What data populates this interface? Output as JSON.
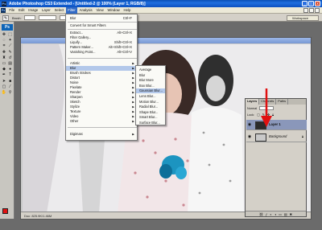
{
  "window": {
    "title": "Adobe Photoshop CS3 Extended - [Untitled-2 @ 100% (Layer 1, RGB/8)]",
    "app_icon": "Ps",
    "buttons": [
      "_",
      "□",
      "x"
    ]
  },
  "menubar": {
    "logo": "Ps",
    "items": [
      "File",
      "Edit",
      "Image",
      "Layer",
      "Select",
      "Filter",
      "Analysis",
      "View",
      "Window",
      "Help"
    ],
    "active": "Filter"
  },
  "options": {
    "brush_label": "Brush:",
    "workspace": "Workspace"
  },
  "filter_menu": {
    "top": [
      {
        "label": "Blur",
        "shortcut": "Ctrl+F"
      }
    ],
    "group1": [
      {
        "label": "Convert for Smart Filters"
      }
    ],
    "group2": [
      {
        "label": "Extract...",
        "shortcut": "Alt+Ctrl+X"
      },
      {
        "label": "Filter Gallery..."
      },
      {
        "label": "Liquify...",
        "shortcut": "Shift+Ctrl+X"
      },
      {
        "label": "Pattern Maker...",
        "shortcut": "Alt+Shift+Ctrl+X"
      },
      {
        "label": "Vanishing Point...",
        "shortcut": "Alt+Ctrl+V"
      }
    ],
    "group3": [
      {
        "label": "Artistic"
      },
      {
        "label": "Blur"
      },
      {
        "label": "Brush Strokes"
      },
      {
        "label": "Distort"
      },
      {
        "label": "Noise"
      },
      {
        "label": "Pixelate"
      },
      {
        "label": "Render"
      },
      {
        "label": "Sharpen"
      },
      {
        "label": "Sketch"
      },
      {
        "label": "Stylize"
      },
      {
        "label": "Texture"
      },
      {
        "label": "Video"
      },
      {
        "label": "Other"
      }
    ],
    "group4": [
      {
        "label": "Digimarc"
      }
    ],
    "highlighted": "Blur"
  },
  "blur_submenu": {
    "items": [
      "Average",
      "Blur",
      "Blur More",
      "Box Blur...",
      "Gaussian Blur...",
      "Lens Blur...",
      "Motion Blur...",
      "Radial Blur...",
      "Shape Blur...",
      "Smart Blur...",
      "Surface Blur..."
    ],
    "highlighted": "Gaussian Blur..."
  },
  "document": {
    "status": "Doc: 825.9K/1.46M"
  },
  "layers_panel": {
    "tabs": [
      "Layers",
      "Channels",
      "Paths"
    ],
    "active_tab": "Layers",
    "blend_mode": "Normal",
    "lock_label": "Lock:",
    "layers": [
      {
        "name": "Layer 1",
        "selected": true
      },
      {
        "name": "Background",
        "selected": false
      }
    ]
  },
  "colors": {
    "foreground": "#e01111",
    "background": "#ffffff",
    "highlight": "#316ac5",
    "arrow": "#e01010"
  }
}
